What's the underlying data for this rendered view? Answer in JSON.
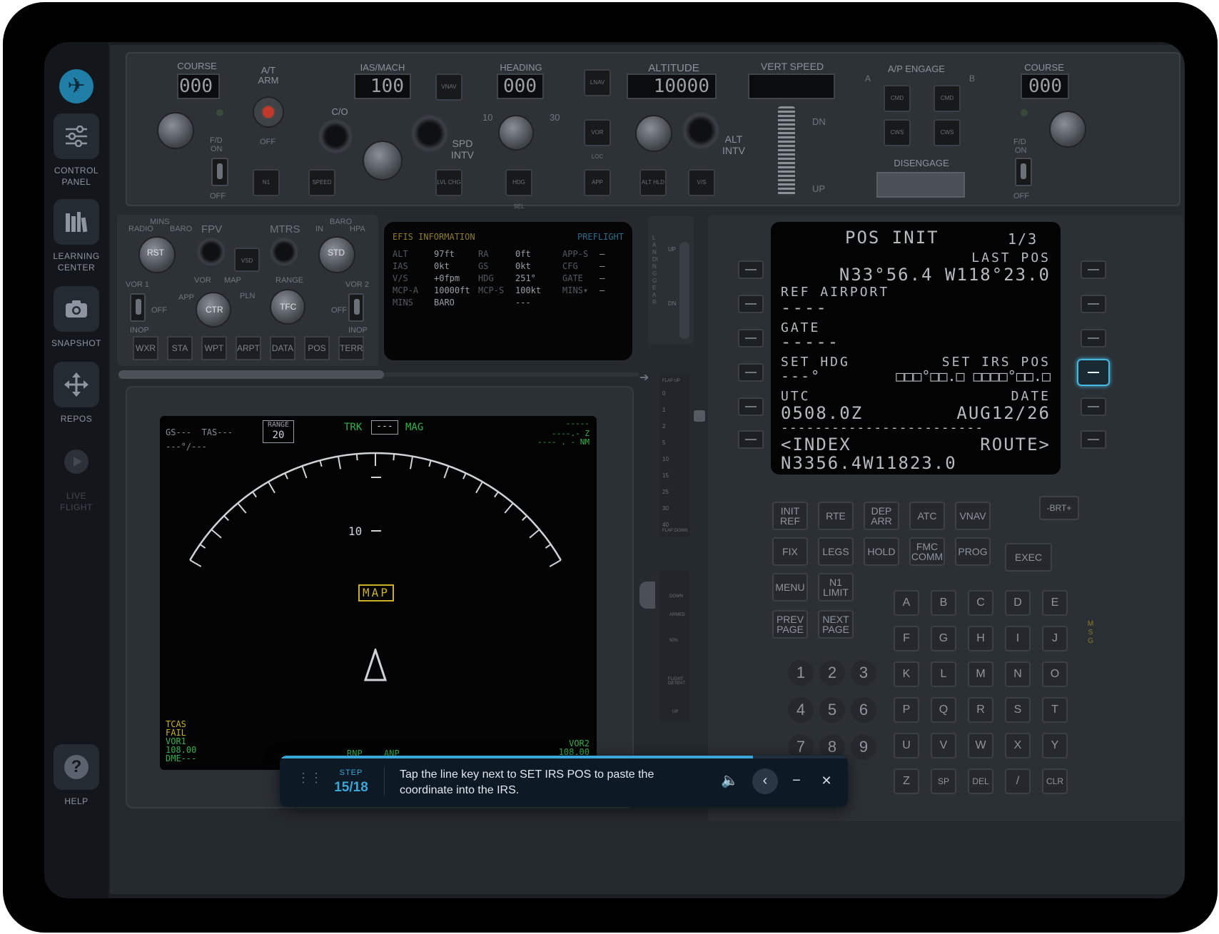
{
  "sidebar": {
    "items": [
      {
        "label_line1": "CONTROL",
        "label_line2": "PANEL",
        "icon": "sliders-icon"
      },
      {
        "label_line1": "LEARNING",
        "label_line2": "CENTER",
        "icon": "books-icon"
      },
      {
        "label_line1": "SNAPSHOT",
        "label_line2": "",
        "icon": "camera-icon"
      },
      {
        "label_line1": "REPOS",
        "label_line2": "",
        "icon": "move-arrows-icon"
      },
      {
        "label_line1": "LIVE",
        "label_line2": "FLIGHT",
        "icon": "play-icon",
        "disabled": true
      }
    ],
    "help_label": "HELP",
    "help_glyph": "?"
  },
  "mcp": {
    "course_left_label": "COURSE",
    "course_left_value": "000",
    "at_arm_label": "A/T",
    "at_arm_label2": "ARM",
    "at_off": "OFF",
    "fd_label": "F/D",
    "fd_on": "ON",
    "fd_off": "OFF",
    "n1": "N1",
    "speed": "SPEED",
    "co": "C/O",
    "ias_label": "IAS/MACH",
    "ias_value": "100",
    "vnav": "VNAV",
    "spd_intv": "SPD",
    "spd_intv2": "INTV",
    "lvl_chg": "LVL CHG",
    "heading_label": "HEADING",
    "heading_value": "000",
    "hdg_10": "10",
    "hdg_30": "30",
    "hdg_sel": "HDG SEL",
    "lnav": "LNAV",
    "vorloc": "VOR LOC",
    "app": "APP",
    "altitude_label": "ALTITUDE",
    "altitude_value": "10000",
    "alt_hld": "ALT HLD",
    "alt_intv": "ALT",
    "alt_intv2": "INTV",
    "vs": "V/S",
    "vert_speed_label": "VERT SPEED",
    "vs_dn": "DN",
    "vs_up": "UP",
    "ap_engage_label": "A/P ENGAGE",
    "ap_a": "A",
    "ap_b": "B",
    "cmd": "CMD",
    "cws": "CWS",
    "disengage": "DISENGAGE",
    "course_right_label": "COURSE",
    "course_right_value": "000",
    "plus": "+",
    "minus": "−"
  },
  "efis_panel": {
    "radio": "RADIO",
    "mins": "MINS",
    "baro": "BARO",
    "rst": "RST",
    "fpv": "FPV",
    "mtrs": "MTRS",
    "vsd": "VSD",
    "in": "IN",
    "hpa": "HPA",
    "std": "STD",
    "vor1": "VOR 1",
    "vor2": "VOR 2",
    "off": "OFF",
    "inop": "INOP",
    "app": "APP",
    "vor": "VOR",
    "map": "MAP",
    "pln": "PLN",
    "ctr": "CTR",
    "range": "RANGE",
    "tfc": "TFC",
    "buttons": [
      "WXR",
      "STA",
      "WPT",
      "ARPT",
      "DATA",
      "POS",
      "TERR"
    ]
  },
  "efis_info": {
    "title": "EFIS INFORMATION",
    "status": "PREFLIGHT",
    "rows": [
      [
        "ALT",
        "97ft",
        "RA",
        "0ft",
        "APP-S",
        "—"
      ],
      [
        "IAS",
        "0kt",
        "GS",
        "0kt",
        "CFG",
        "—"
      ],
      [
        "V/S",
        "+0fpm",
        "HDG",
        "251°",
        "GATE",
        "—"
      ],
      [
        "MCP-A",
        "10000ft",
        "MCP-S",
        "100kt",
        "MINS▾",
        "—"
      ],
      [
        "MINS",
        "BARO",
        "",
        "---",
        "",
        ""
      ]
    ]
  },
  "nd": {
    "gs_tas": "GS---  TAS---",
    "wind": "---°/---",
    "range_label": "RANGE",
    "range_value": "20",
    "trk": "TRK",
    "hdg_box": "---",
    "mag": "MAG",
    "wpt_dash": "-----",
    "wpt_dist": "---- . - NM",
    "wpt_z": "----.- Z",
    "ring_label": "10",
    "map_flag": "MAP",
    "tcas": "TCAS",
    "fail": "FAIL",
    "vor1": "VOR1",
    "vor1_freq": "108.00",
    "dme": "DME---",
    "rnp": "RNP",
    "anp": "ANP",
    "vor2": "VOR2",
    "vor2_freq": "108.00"
  },
  "gear": {
    "label": "LANDING GEAR",
    "up": "UP",
    "dn": "DN"
  },
  "flaps": {
    "label": "FLAP UP",
    "ticks": [
      "0",
      "1",
      "2",
      "5",
      "10",
      "15",
      "25",
      "30",
      "40"
    ],
    "bottom": "FLAP DOWN"
  },
  "speedbrake": {
    "down": "DOWN",
    "armed": "ARMED",
    "fifty": "50%",
    "flight_detent": "FLIGHT DETENT",
    "up": "UP"
  },
  "cdu": {
    "title": "POS INIT",
    "page": "1/3",
    "l1_label": "LAST POS",
    "l1_value": "N33°56.4 W118°23.0",
    "l2_label": "REF AIRPORT",
    "l2_value": "----",
    "l3_label": "GATE",
    "l3_value": "-----",
    "l4_label_left": "SET HDG",
    "l4_label_right": "SET IRS POS",
    "l4_value_left": "---°",
    "l4_value_right": "□□□°□□.□ □□□□°□□.□",
    "l5_label_left": "UTC",
    "l5_label_right": "DATE",
    "l5_value_left": "0508.0Z",
    "l5_value_right": "AUG12/26",
    "separator": "------------------------",
    "l6_left": "<INDEX",
    "l6_right": "ROUTE>",
    "scratchpad": "N3356.4W11823.0",
    "brt": "-BRT+",
    "msg": "MSG",
    "func_keys": [
      [
        "INIT",
        "REF"
      ],
      [
        "RTE",
        ""
      ],
      [
        "DEP",
        "ARR"
      ],
      [
        "ATC",
        ""
      ],
      [
        "VNAV",
        ""
      ],
      [
        "FIX",
        ""
      ],
      [
        "LEGS",
        ""
      ],
      [
        "HOLD",
        ""
      ],
      [
        "FMC",
        "COMM"
      ],
      [
        "PROG",
        ""
      ],
      [
        "MENU",
        ""
      ],
      [
        "N1",
        "LIMIT"
      ],
      [
        "PREV",
        "PAGE"
      ],
      [
        "NEXT",
        "PAGE"
      ]
    ],
    "exec": "EXEC",
    "alpha": [
      "A",
      "B",
      "C",
      "D",
      "E",
      "F",
      "G",
      "H",
      "I",
      "J",
      "K",
      "L",
      "M",
      "N",
      "O",
      "P",
      "Q",
      "R",
      "S",
      "T",
      "U",
      "V",
      "W",
      "X",
      "Y",
      "Z",
      "SP",
      "DEL",
      "/",
      "CLR"
    ],
    "digits": [
      "1",
      "2",
      "3",
      "4",
      "5",
      "6",
      "7",
      "8",
      "9"
    ]
  },
  "tour": {
    "step_label": "STEP",
    "step_value": "15/18",
    "progress": 0.833,
    "message": "Tap the line key next to SET IRS POS to paste the coordinate into the IRS.",
    "prev_glyph": "‹",
    "minimize_glyph": "−",
    "close_glyph": "✕",
    "volume_glyph": "🔈"
  },
  "colors": {
    "accent": "#3aa7d8",
    "nd_green": "#2fb34a",
    "nd_yellow": "#c9b22a",
    "efis_title": "#8d7a2e"
  }
}
